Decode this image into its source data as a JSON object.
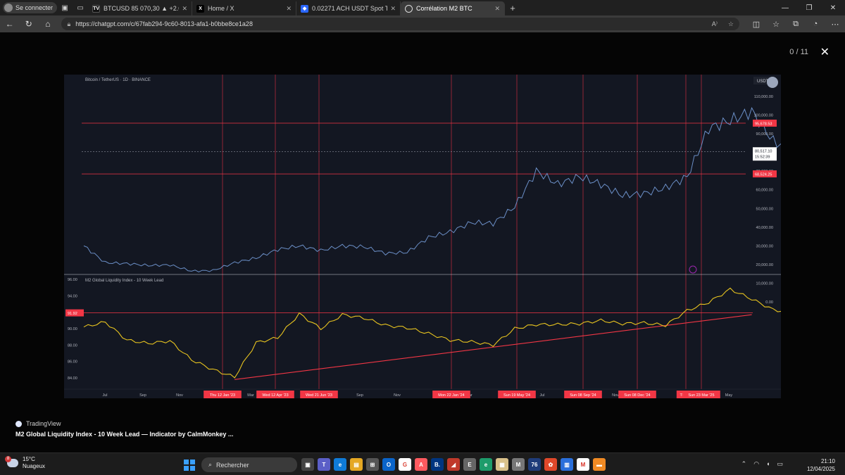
{
  "browser": {
    "profile_label": "Se connecter",
    "tabs": [
      {
        "label": "BTCUSD 85 070,30 ▲ +2.03% Anonyme",
        "favicon": "TV",
        "fav_color": "#111111"
      },
      {
        "label": "Home / X",
        "favicon": "X",
        "fav_color": "#000000"
      },
      {
        "label": "0.02271 ACH USDT Spot Trading",
        "favicon": "◆",
        "fav_color": "#2b67ff"
      },
      {
        "label": "Corrélation M2 BTC",
        "favicon": "◎",
        "fav_color": "#3b3b3b",
        "active": true
      }
    ],
    "url": "https://chatgpt.com/c/67fab294-9c60-8013-afa1-b0bbe8ce1a28"
  },
  "viewer": {
    "counter": "0 / 11",
    "caption_source": "TradingView",
    "caption_title": "M2 Global Liquidity Index - 10 Week Lead — Indicator by CalmMonkey ..."
  },
  "chart_data": [
    {
      "type": "line",
      "title": "Bitcoin / TetherUS · 1D · BINANCE",
      "currency_label": "USDT",
      "y_axis_ticks": [
        "110,000.00",
        "100,000.00",
        "90,000.00",
        "80,000.00",
        "70,000.00",
        "60,000.00",
        "50,000.00",
        "40,000.00",
        "30,000.00",
        "20,000.00",
        "10,000.00",
        "0.00"
      ],
      "price_tags": [
        {
          "text": "95,678.53",
          "color": "#f23645"
        },
        {
          "text": "80,517.10",
          "color": "#ffffff"
        },
        {
          "text": "15:52:39",
          "color": "#ffffff"
        },
        {
          "text": "68,524.25",
          "color": "#f23645"
        }
      ],
      "horizontal_levels": [
        95678.53,
        68524.25
      ],
      "last_price": 80517.1,
      "series": [
        {
          "color": "#6b8fc7",
          "x": [
            "2022-06",
            "2022-07",
            "2022-08",
            "2022-09",
            "2022-10",
            "2022-11",
            "2022-12",
            "2023-01",
            "2023-02",
            "2023-03",
            "2023-04",
            "2023-05",
            "2023-06",
            "2023-07",
            "2023-08",
            "2023-09",
            "2023-10",
            "2023-11",
            "2023-12",
            "2024-01",
            "2024-02",
            "2024-03",
            "2024-04",
            "2024-05",
            "2024-06",
            "2024-07",
            "2024-08",
            "2024-09",
            "2024-10",
            "2024-11",
            "2024-12",
            "2025-01",
            "2025-02",
            "2025-03"
          ],
          "values": [
            30000,
            21000,
            20500,
            19500,
            19800,
            16500,
            16800,
            21000,
            23500,
            28000,
            30000,
            27500,
            30000,
            29500,
            26000,
            26500,
            34500,
            37500,
            42500,
            42000,
            51000,
            70000,
            63000,
            67000,
            63000,
            57000,
            58000,
            61000,
            67000,
            93000,
            97000,
            102000,
            86000,
            80500
          ]
        }
      ]
    },
    {
      "type": "line",
      "title": "M2 Global Liquidity Index - 10 Week Lead",
      "y_axis_ticks": [
        "96.00",
        "94.00",
        "92.00",
        "90.00",
        "88.00",
        "86.00",
        "84.00"
      ],
      "level_tag": "91.92",
      "horizontal_level": 91.92,
      "series": [
        {
          "color": "#e8c41f",
          "x": [
            "2022-06",
            "2022-07",
            "2022-08",
            "2022-09",
            "2022-10",
            "2022-11",
            "2022-12",
            "2023-01",
            "2023-02",
            "2023-03",
            "2023-04",
            "2023-05",
            "2023-06",
            "2023-07",
            "2023-08",
            "2023-09",
            "2023-10",
            "2023-11",
            "2023-12",
            "2024-01",
            "2024-02",
            "2024-03",
            "2024-04",
            "2024-05",
            "2024-06",
            "2024-07",
            "2024-08",
            "2024-09",
            "2024-10",
            "2024-11",
            "2024-12",
            "2025-01",
            "2025-02",
            "2025-03",
            "2025-04",
            "2025-05",
            "2025-06"
          ],
          "values": [
            90.2,
            90.8,
            88.6,
            88.2,
            88.5,
            86.2,
            85.0,
            84.1,
            88.3,
            88.9,
            91.8,
            90.0,
            91.7,
            91.3,
            90.4,
            90.1,
            89.4,
            88.6,
            88.4,
            88.0,
            90.0,
            90.5,
            90.5,
            90.6,
            91.0,
            90.6,
            90.7,
            90.4,
            92.2,
            93.2,
            94.8,
            93.6,
            92.3,
            91.9,
            92.3,
            93.5,
            95.0
          ]
        }
      ],
      "trendline": {
        "from": {
          "x": "2023-01",
          "y": 83.8
        },
        "to": {
          "x": "2025-01",
          "y": 91.7
        },
        "color": "#f23645"
      }
    }
  ],
  "time_axis": {
    "labels": [
      "Jul",
      "Sep",
      "Nov",
      "Mar",
      "Sep",
      "Nov",
      "Mar",
      "Jul",
      "Nov",
      "May"
    ],
    "event_tags": [
      "Thu 12 Jan '23",
      "Wed 12 Apr '23",
      "Wed 21 Jun '23",
      "Mon 22 Jan '24",
      "Sun 19 May '24",
      "Sun 08 Sep '24",
      "Sun 08 Dec '24",
      "Thu 27",
      "Sun 23 Mar '25"
    ]
  },
  "taskbar": {
    "temperature": "15°C",
    "weather": "Nuageux",
    "weather_badge": "8",
    "search_label": "Rechercher",
    "time": "21:10",
    "date": "12/04/2025"
  }
}
